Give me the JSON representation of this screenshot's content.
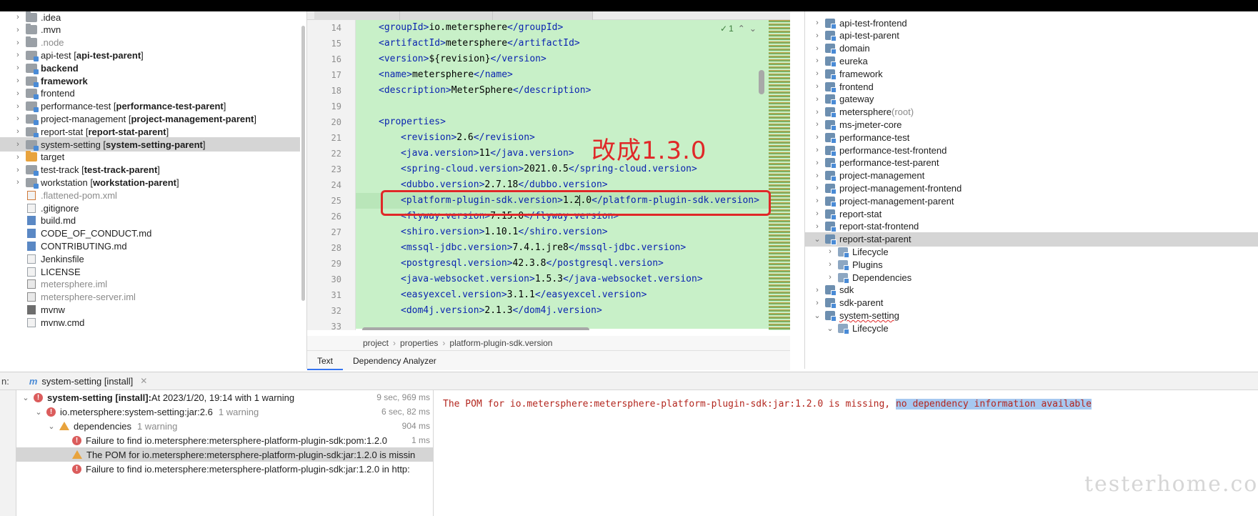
{
  "project_tree": [
    {
      "name": ".idea",
      "icon": "folder-gray",
      "expandable": true
    },
    {
      "name": ".mvn",
      "icon": "folder-gray",
      "expandable": true
    },
    {
      "name": ".node",
      "icon": "folder-gray",
      "expandable": true,
      "dim": true
    },
    {
      "name": "api-test",
      "icon": "module",
      "expandable": true,
      "suffix_open": " [",
      "suffix_bold": "api-test-parent",
      "suffix_close": "]"
    },
    {
      "name": "backend",
      "icon": "module",
      "expandable": true,
      "bold": true
    },
    {
      "name": "framework",
      "icon": "module",
      "expandable": true,
      "bold": true
    },
    {
      "name": "frontend",
      "icon": "module",
      "expandable": true
    },
    {
      "name": "performance-test",
      "icon": "module",
      "expandable": true,
      "suffix_open": " [",
      "suffix_bold": "performance-test-parent",
      "suffix_close": "]"
    },
    {
      "name": "project-management",
      "icon": "module",
      "expandable": true,
      "suffix_open": " [",
      "suffix_bold": "project-management-parent",
      "suffix_close": "]"
    },
    {
      "name": "report-stat",
      "icon": "module",
      "expandable": true,
      "suffix_open": " [",
      "suffix_bold": "report-stat-parent",
      "suffix_close": "]"
    },
    {
      "name": "system-setting",
      "icon": "module",
      "expandable": true,
      "selected": true,
      "suffix_open": " [",
      "suffix_bold": "system-setting-parent",
      "suffix_close": "]"
    },
    {
      "name": "target",
      "icon": "folder-orange",
      "expandable": true
    },
    {
      "name": "test-track",
      "icon": "module",
      "expandable": true,
      "suffix_open": " [",
      "suffix_bold": "test-track-parent",
      "suffix_close": "]"
    },
    {
      "name": "workstation",
      "icon": "module",
      "expandable": true,
      "suffix_open": " [",
      "suffix_bold": "workstation-parent",
      "suffix_close": "]"
    },
    {
      "name": ".flattened-pom.xml",
      "icon": "file-xml",
      "dim": true
    },
    {
      "name": ".gitignore",
      "icon": "file"
    },
    {
      "name": "build.md",
      "icon": "file-md"
    },
    {
      "name": "CODE_OF_CONDUCT.md",
      "icon": "file-md"
    },
    {
      "name": "CONTRIBUTING.md",
      "icon": "file-md"
    },
    {
      "name": "Jenkinsfile",
      "icon": "file"
    },
    {
      "name": "LICENSE",
      "icon": "file"
    },
    {
      "name": "metersphere.iml",
      "icon": "file-iml",
      "dim": true
    },
    {
      "name": "metersphere-server.iml",
      "icon": "file-iml",
      "dim": true
    },
    {
      "name": "mvnw",
      "icon": "file-script"
    },
    {
      "name": "mvnw.cmd",
      "icon": "file"
    }
  ],
  "editor": {
    "inspection_count": "1",
    "current_line": 25,
    "lines": [
      {
        "n": "14",
        "indent": 1,
        "tag": "groupId",
        "value": "io.metersphere"
      },
      {
        "n": "15",
        "indent": 1,
        "tag": "artifactId",
        "value": "metersphere"
      },
      {
        "n": "16",
        "indent": 1,
        "tag": "version",
        "value": "${revision}"
      },
      {
        "n": "17",
        "indent": 1,
        "tag": "name",
        "value": "metersphere"
      },
      {
        "n": "18",
        "indent": 1,
        "tag": "description",
        "value": "MeterSphere"
      },
      {
        "n": "19",
        "indent": 0,
        "tag": "",
        "value": ""
      },
      {
        "n": "20",
        "indent": 1,
        "tag": "properties",
        "open_only": true
      },
      {
        "n": "21",
        "indent": 2,
        "tag": "revision",
        "value": "2.6"
      },
      {
        "n": "22",
        "indent": 2,
        "tag": "java.version",
        "value": "11"
      },
      {
        "n": "23",
        "indent": 2,
        "tag": "spring-cloud.version",
        "value": "2021.0.5"
      },
      {
        "n": "24",
        "indent": 2,
        "tag": "dubbo.version",
        "value": "2.7.18"
      },
      {
        "n": "25",
        "indent": 2,
        "tag": "platform-plugin-sdk.version",
        "value_before_caret": "1.2",
        "value_after_caret": ".0"
      },
      {
        "n": "26",
        "indent": 2,
        "tag": "flyway.version",
        "value": "7.15.0"
      },
      {
        "n": "27",
        "indent": 2,
        "tag": "shiro.version",
        "value": "1.10.1"
      },
      {
        "n": "28",
        "indent": 2,
        "tag": "mssql-jdbc.version",
        "value": "7.4.1.jre8"
      },
      {
        "n": "29",
        "indent": 2,
        "tag": "postgresql.version",
        "value": "42.3.8"
      },
      {
        "n": "30",
        "indent": 2,
        "tag": "java-websocket.version",
        "value": "1.5.3"
      },
      {
        "n": "31",
        "indent": 2,
        "tag": "easyexcel.version",
        "value": "3.1.1"
      },
      {
        "n": "32",
        "indent": 2,
        "tag": "dom4j.version",
        "value": "2.1.3"
      },
      {
        "n": "33",
        "indent": 0,
        "tag": "",
        "value": ""
      }
    ],
    "annotation": "改成1.3.0",
    "annotation_color": "#e02828",
    "breadcrumb": [
      "project",
      "properties",
      "platform-plugin-sdk.version"
    ],
    "bottom_tabs": [
      {
        "label": "Text",
        "active": true
      },
      {
        "label": "Dependency Analyzer",
        "active": false
      }
    ]
  },
  "maven_tree": [
    {
      "name": "api-test-frontend",
      "level": 0,
      "chev": "right"
    },
    {
      "name": "api-test-parent",
      "level": 0,
      "chev": "right"
    },
    {
      "name": "domain",
      "level": 0,
      "chev": "right"
    },
    {
      "name": "eureka",
      "level": 0,
      "chev": "right"
    },
    {
      "name": "framework",
      "level": 0,
      "chev": "right"
    },
    {
      "name": "frontend",
      "level": 0,
      "chev": "right"
    },
    {
      "name": "gateway",
      "level": 0,
      "chev": "right"
    },
    {
      "name": "metersphere",
      "suffix": " (root)",
      "level": 0,
      "chev": "right"
    },
    {
      "name": "ms-jmeter-core",
      "level": 0,
      "chev": "right"
    },
    {
      "name": "performance-test",
      "level": 0,
      "chev": "right"
    },
    {
      "name": "performance-test-frontend",
      "level": 0,
      "chev": "right"
    },
    {
      "name": "performance-test-parent",
      "level": 0,
      "chev": "right"
    },
    {
      "name": "project-management",
      "level": 0,
      "chev": "right"
    },
    {
      "name": "project-management-frontend",
      "level": 0,
      "chev": "right"
    },
    {
      "name": "project-management-parent",
      "level": 0,
      "chev": "right"
    },
    {
      "name": "report-stat",
      "level": 0,
      "chev": "right"
    },
    {
      "name": "report-stat-frontend",
      "level": 0,
      "chev": "right"
    },
    {
      "name": "report-stat-parent",
      "level": 0,
      "chev": "down",
      "selected": true
    },
    {
      "name": "Lifecycle",
      "level": 1,
      "chev": "right",
      "folder": true
    },
    {
      "name": "Plugins",
      "level": 1,
      "chev": "right",
      "folder": true
    },
    {
      "name": "Dependencies",
      "level": 1,
      "chev": "right",
      "folder": true
    },
    {
      "name": "sdk",
      "level": 0,
      "chev": "right"
    },
    {
      "name": "sdk-parent",
      "level": 0,
      "chev": "right"
    },
    {
      "name": "system-setting",
      "level": 0,
      "chev": "down",
      "squiggle": true
    },
    {
      "name": "Lifecycle",
      "level": 1,
      "chev": "down",
      "folder": true
    }
  ],
  "run_panel": {
    "prefix": "n:",
    "tab_label": "system-setting [install]",
    "tree": [
      {
        "level": 0,
        "chev": "down",
        "icon": "error",
        "bold": "system-setting [install]:",
        "text": " At 2023/1/20, 19:14 with 1 warning",
        "time": "9 sec, 969 ms"
      },
      {
        "level": 1,
        "chev": "down",
        "icon": "error",
        "text": "io.metersphere:system-setting:jar:2.6",
        "muted": "1 warning",
        "time": "6 sec, 82 ms"
      },
      {
        "level": 2,
        "chev": "down",
        "icon": "warning",
        "text": "dependencies",
        "muted": "1 warning",
        "time": "904 ms"
      },
      {
        "level": 3,
        "chev": "none",
        "icon": "error",
        "text": "Failure to find io.metersphere:metersphere-platform-plugin-sdk:pom:1.2.0",
        "time": "1 ms"
      },
      {
        "level": 3,
        "chev": "none",
        "icon": "warning",
        "text": "The POM for io.metersphere:metersphere-platform-plugin-sdk:jar:1.2.0 is missin",
        "selected": true
      },
      {
        "level": 3,
        "chev": "none",
        "icon": "error",
        "text": "Failure to find io.metersphere:metersphere-platform-plugin-sdk:jar:1.2.0 in http:"
      }
    ],
    "console_text": "The POM for io.metersphere:metersphere-platform-plugin-sdk:jar:1.2.0 is missing, ",
    "console_highlight": "no dependency information available"
  },
  "watermark": "testerhome.com"
}
